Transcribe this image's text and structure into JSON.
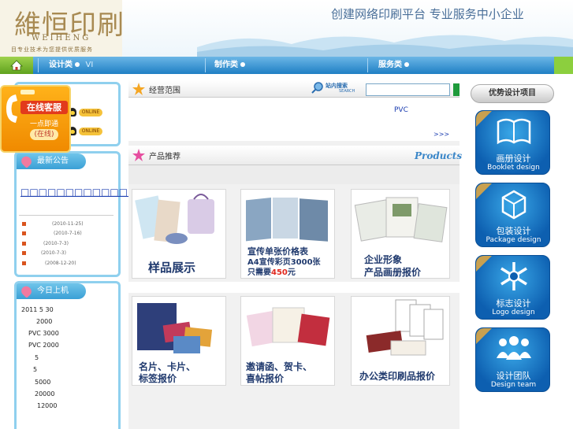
{
  "header": {
    "logo_cn": "維恒印刷",
    "logo_en": "WEIHENG",
    "logo_sub": "目专业技术为您提供优质服务",
    "slogan": "创建网络印刷平台  专业服务中小企业"
  },
  "nav": {
    "items": [
      {
        "label": "设计类",
        "suffix": "VI"
      },
      {
        "label": "制作类",
        "suffix": ""
      },
      {
        "label": "服务类",
        "suffix": ""
      }
    ]
  },
  "service": {
    "line1": "在线客服",
    "line2": "一点即通",
    "line3": "(在线)"
  },
  "qq": {
    "online_label": "ONLINE"
  },
  "notice": {
    "title": "最新公告",
    "headline": "□□□□□□□□□□□□□□□□□□□□□□",
    "dates": [
      "(2010-11-25)",
      "(2010-7-16)",
      "(2010-7-3)",
      "(2010-7-3)",
      "(2008-12-20)"
    ]
  },
  "today": {
    "title": "今日上机",
    "items": [
      "2011 5 30",
      "2000",
      "PVC 3000",
      "PVC 2000",
      "5",
      "5",
      "5000",
      "20000",
      "12000"
    ]
  },
  "scope": {
    "title": "经营范围",
    "search_badge": "站内搜索",
    "search_en": "SEARCH",
    "search_value": "",
    "pvc": "PVC",
    "more": ">>>"
  },
  "products": {
    "title": "产品推荐",
    "title_en": "Products",
    "items": [
      {
        "lines": [
          "样品展示"
        ]
      },
      {
        "lines": [
          "宣传单张价格表",
          "A4宣传彩页3000张",
          "只需要"
        ],
        "price": "450",
        "unit": "元"
      },
      {
        "lines": [
          "企业形象",
          "产品画册报价"
        ]
      },
      {
        "lines": [
          "名片、卡片、",
          "标签报价"
        ]
      },
      {
        "lines": [
          "邀请函、贺卡、",
          "喜帖报价"
        ]
      },
      {
        "lines": [
          "办公类印刷品报价"
        ]
      }
    ]
  },
  "right": {
    "title": "优势设计项目",
    "items": [
      {
        "cn": "画册设计",
        "en": "Booklet design",
        "icon": "booklet-icon"
      },
      {
        "cn": "包装设计",
        "en": "Package design",
        "icon": "package-icon"
      },
      {
        "cn": "标志设计",
        "en": "Logo design",
        "icon": "logo-icon"
      },
      {
        "cn": "设计团队",
        "en": "Design team",
        "icon": "team-icon"
      }
    ]
  },
  "colors": {
    "nav_blue": "#1f7fc4",
    "accent_orange": "#f08a00",
    "price_red": "#e0281e",
    "link_blue": "#1a3cb0"
  }
}
